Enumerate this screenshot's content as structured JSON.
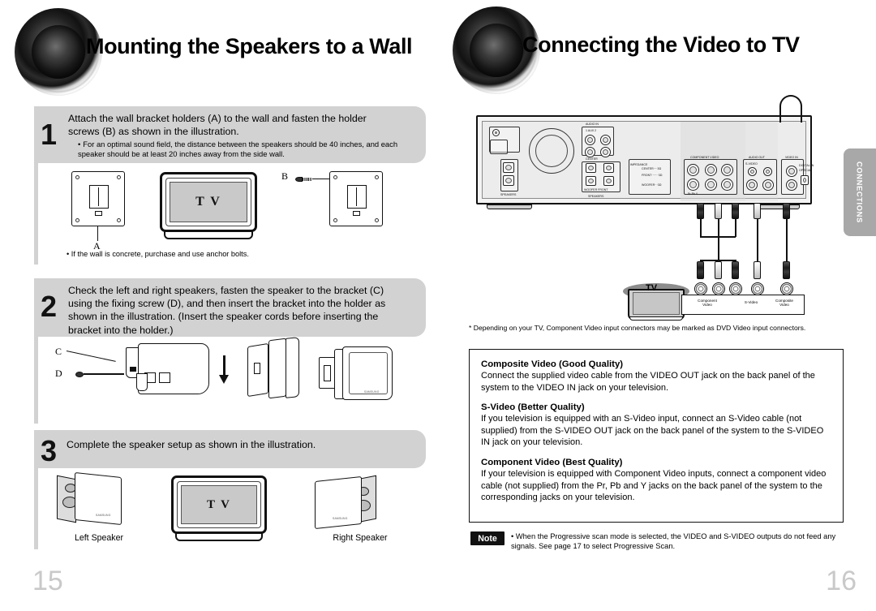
{
  "document": {
    "type": "product-manual-spread",
    "left_page_number": "15",
    "right_page_number": "16",
    "side_tab_label": "CONNECTIONS"
  },
  "left_page": {
    "title": "Mounting the Speakers to a Wall",
    "logo_icon": "speaker-cone-icon",
    "steps": [
      {
        "number": "1",
        "text": "Attach the wall bracket holders (A) to the wall and fasten the holder screws (B) as shown in the illustration.",
        "bullets": [
          "For an optimal sound field, the distance between the speakers should be 40 inches, and each speaker should be at least 20 inches away from the side wall."
        ],
        "figure": {
          "labels": [
            "A",
            "B"
          ],
          "tv_screen_text": "T V"
        },
        "figure_note": "If the wall is concrete, purchase and use anchor bolts."
      },
      {
        "number": "2",
        "text": "Check the left and right speakers, fasten the speaker to the bracket (C) using the fixing screw (D), and then insert the bracket into the holder as shown in the illustration. (Insert the speaker cords before inserting the bracket into the holder.)",
        "bullets": [],
        "figure": {
          "labels": [
            "C",
            "D"
          ]
        }
      },
      {
        "number": "3",
        "text": "Complete the speaker setup as shown in the illustration.",
        "bullets": [],
        "figure": {
          "left_speaker_label": "Left Speaker",
          "right_speaker_label": "Right Speaker",
          "tv_screen_text": "T V"
        }
      }
    ]
  },
  "right_page": {
    "title": "Connecting the Video to TV",
    "logo_icon": "speaker-cone-icon",
    "diagram": {
      "tv_label": "TV",
      "jack_labels": [
        "Component Video",
        "S-Video",
        "Composite Video"
      ],
      "panel_labels": [
        "AUDIO IN",
        "AUX",
        "1",
        "2",
        "SPEAKERS",
        "CENTER",
        "WOOFER",
        "FRONT",
        "IMPEDANCE",
        "COMPONENT VIDEO",
        "Pr",
        "Pb",
        "Y",
        "VIDEO OUT",
        "S-VIDEO",
        "VIDEO",
        "AUDIO OUT",
        "DIGITAL IN OPTICAL",
        "FM ANT",
        "COAXIAL"
      ]
    },
    "footnote": "*   Depending on your TV, Component Video input connectors may be marked as DVD Video input connectors.",
    "info_sections": [
      {
        "heading": "Composite Video (Good Quality)",
        "body": "Connect the supplied video cable from the VIDEO OUT jack on the back panel of the system to the VIDEO IN jack on your television."
      },
      {
        "heading": "S-Video (Better Quality)",
        "body": "If you television is equipped with an S-Video input, connect an S-Video cable (not supplied) from the S-VIDEO OUT jack on the back panel of the system to the S-VIDEO IN jack on your television."
      },
      {
        "heading": "Component Video (Best Quality)",
        "body": "If your television is equipped with Component Video inputs, connect a component video cable (not supplied) from the Pr, Pb and Y jacks on the back panel of the system to the corresponding jacks on your television."
      }
    ],
    "note": {
      "badge": "Note",
      "bullet": "•",
      "text": "When the Progressive scan mode is selected, the VIDEO and S-VIDEO outputs do not feed any signals. See page 17 to select Progressive Scan."
    }
  },
  "colors": {
    "step_box_bg": "#d2d2d2",
    "tv_screen": "#c9c9c9",
    "side_tab": "#a8a8a8",
    "page_number": "#c9c9c9",
    "note_badge_bg": "#111111"
  }
}
